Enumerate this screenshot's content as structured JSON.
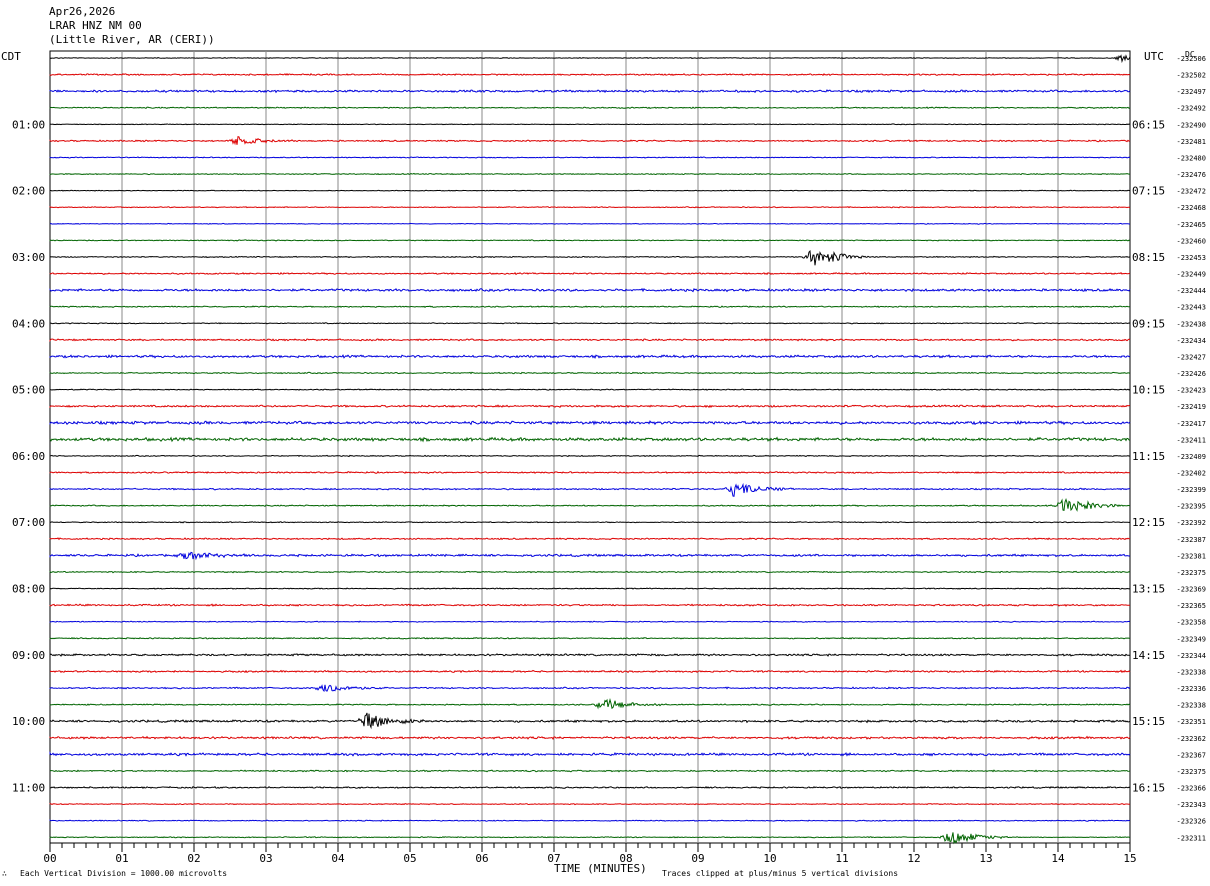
{
  "header": {
    "date": "Apr26,2026",
    "station": "LRAR HNZ NM 00",
    "location": "(Little River, AR (CERI))"
  },
  "left_tz": "CDT",
  "right_tz": "UTC",
  "dc_label": "DC",
  "footer": {
    "scale_note": "Each Vertical Division = 1000.00 microvolts",
    "clip_note": "Traces clipped at plus/minus 5 vertical divisions",
    "corner_mark": "∴"
  },
  "chart_data": {
    "type": "line",
    "xlabel": "TIME (MINUTES)",
    "x_ticks": [
      "00",
      "01",
      "02",
      "03",
      "04",
      "05",
      "06",
      "07",
      "08",
      "09",
      "10",
      "11",
      "12",
      "13",
      "14",
      "15"
    ],
    "xlim": [
      0,
      15
    ],
    "left_time_labels": [
      "01:00",
      "02:00",
      "03:00",
      "04:00",
      "05:00",
      "06:00",
      "07:00",
      "08:00",
      "09:00",
      "10:00",
      "11:00"
    ],
    "right_time_labels": [
      "06:15",
      "07:15",
      "08:15",
      "09:15",
      "10:15",
      "11:15",
      "12:15",
      "13:15",
      "14:15",
      "15:15",
      "16:15"
    ],
    "trace_colors": [
      "#000000",
      "#dd0000",
      "#0000dd",
      "#006400"
    ],
    "dc_offsets": [
      "-232506",
      "-232502",
      "-232497",
      "-232492",
      "-232490",
      "-232481",
      "-232480",
      "-232476",
      "-232472",
      "-232468",
      "-232465",
      "-232460",
      "-232453",
      "-232449",
      "-232444",
      "-232443",
      "-232438",
      "-232434",
      "-232427",
      "-232426",
      "-232423",
      "-232419",
      "-232417",
      "-232411",
      "-232409",
      "-232402",
      "-232399",
      "-232395",
      "-232392",
      "-232387",
      "-232381",
      "-232375",
      "-232369",
      "-232365",
      "-232358",
      "-232349",
      "-232344",
      "-232338",
      "-232336",
      "-232338",
      "-232351",
      "-232362",
      "-232367",
      "-232375",
      "-232366",
      "-232343",
      "-232326",
      "-232311"
    ],
    "noise_levels": [
      0.3,
      0.6,
      0.9,
      0.5,
      0.3,
      0.6,
      0.4,
      0.4,
      0.3,
      0.4,
      0.3,
      0.4,
      0.4,
      0.6,
      1.0,
      0.5,
      0.4,
      0.7,
      1.0,
      0.5,
      0.4,
      0.8,
      1.2,
      1.3,
      0.4,
      0.6,
      0.6,
      0.5,
      0.4,
      0.6,
      0.9,
      0.5,
      0.4,
      0.7,
      0.4,
      0.5,
      0.8,
      0.7,
      0.6,
      0.5,
      0.9,
      0.9,
      1.0,
      0.6,
      0.6,
      0.4,
      0.4,
      0.4
    ],
    "events": [
      {
        "trace": 0,
        "minute": 14.9,
        "amplitude": 4
      },
      {
        "trace": 5,
        "minute": 2.6,
        "amplitude": 5
      },
      {
        "trace": 12,
        "minute": 10.6,
        "amplitude": 12
      },
      {
        "trace": 26,
        "minute": 9.5,
        "amplitude": 8
      },
      {
        "trace": 27,
        "minute": 14.1,
        "amplitude": 10
      },
      {
        "trace": 30,
        "minute": 1.9,
        "amplitude": 5
      },
      {
        "trace": 38,
        "minute": 3.8,
        "amplitude": 6
      },
      {
        "trace": 39,
        "minute": 7.7,
        "amplitude": 7
      },
      {
        "trace": 40,
        "minute": 4.4,
        "amplitude": 9
      },
      {
        "trace": 47,
        "minute": 12.5,
        "amplitude": 10
      }
    ]
  }
}
